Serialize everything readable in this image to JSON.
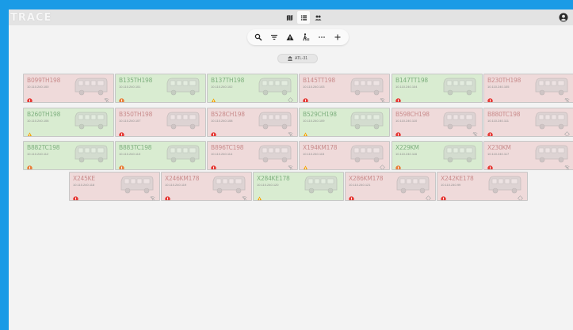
{
  "app": {
    "logo": "TRACE"
  },
  "header": {
    "views": [
      {
        "icon": "map-icon",
        "active": false
      },
      {
        "icon": "list-icon",
        "active": true
      },
      {
        "icon": "people-icon",
        "active": false
      }
    ],
    "account_icon": "account-circle-icon"
  },
  "toolbar": {
    "tools": [
      "search-icon",
      "filter-icon",
      "warning-icon",
      "pedestrian-icon",
      "more-icon",
      "add-icon"
    ]
  },
  "site": {
    "label": "ATL-31",
    "icon": "bank-icon"
  },
  "colors": {
    "red_card": "#efdada",
    "green_card": "#d9ecd1",
    "error": "#e53935",
    "warning": "#f5a300",
    "caution": "#e8803c"
  },
  "vehicles": [
    {
      "name": "B099TH198",
      "ip": "10.110.240.100",
      "state": "red",
      "status": "error",
      "conn": "wifi-off-icon"
    },
    {
      "name": "B135TH198",
      "ip": "10.110.240.101",
      "state": "green",
      "status": "caution",
      "conn": ""
    },
    {
      "name": "B137TH198",
      "ip": "10.110.240.102",
      "state": "green",
      "status": "warning",
      "conn": "signal-diamond-icon"
    },
    {
      "name": "B145TT198",
      "ip": "10.110.240.103",
      "state": "red",
      "status": "error",
      "conn": "wifi-off-icon"
    },
    {
      "name": "B147TT198",
      "ip": "10.110.240.104",
      "state": "green",
      "status": "error",
      "conn": ""
    },
    {
      "name": "B230TH198",
      "ip": "10.110.240.105",
      "state": "red",
      "status": "error",
      "conn": "wifi-off-icon"
    },
    {
      "name": "B260TH198",
      "ip": "10.110.240.106",
      "state": "green",
      "status": "warning",
      "conn": ""
    },
    {
      "name": "B350TH198",
      "ip": "10.110.240.107",
      "state": "red",
      "status": "error",
      "conn": ""
    },
    {
      "name": "B528CH198",
      "ip": "10.110.240.108",
      "state": "red",
      "status": "error",
      "conn": "wifi-off-icon"
    },
    {
      "name": "B529CH198",
      "ip": "10.110.240.109",
      "state": "green",
      "status": "warning",
      "conn": ""
    },
    {
      "name": "B598CH198",
      "ip": "10.110.240.110",
      "state": "red",
      "status": "error",
      "conn": "wifi-off-icon"
    },
    {
      "name": "B880TC198",
      "ip": "10.110.240.111",
      "state": "red",
      "status": "error",
      "conn": "signal-diamond-icon"
    },
    {
      "name": "B882TC198",
      "ip": "10.110.240.112",
      "state": "green",
      "status": "caution",
      "conn": ""
    },
    {
      "name": "B883TC198",
      "ip": "10.110.240.113",
      "state": "green",
      "status": "caution",
      "conn": ""
    },
    {
      "name": "B896TC198",
      "ip": "10.110.240.114",
      "state": "red",
      "status": "error",
      "conn": "wifi-off-icon"
    },
    {
      "name": "X194KM178",
      "ip": "10.110.240.115",
      "state": "red",
      "status": "warning",
      "conn": "signal-diamond-icon"
    },
    {
      "name": "X229KM",
      "ip": "10.110.240.116",
      "state": "green",
      "status": "caution",
      "conn": ""
    },
    {
      "name": "X230KM",
      "ip": "10.110.240.117",
      "state": "red",
      "status": "error",
      "conn": "wifi-off-icon"
    },
    {
      "name": "X245KE",
      "ip": "10.110.240.118",
      "state": "red",
      "status": "error",
      "conn": "wifi-off-icon"
    },
    {
      "name": "X246KM178",
      "ip": "10.110.240.119",
      "state": "red",
      "status": "error",
      "conn": "wifi-off-icon"
    },
    {
      "name": "X284KE178",
      "ip": "10.110.240.120",
      "state": "green",
      "status": "warning",
      "conn": ""
    },
    {
      "name": "X286KM178",
      "ip": "10.110.240.121",
      "state": "red",
      "status": "error",
      "conn": "signal-diamond-icon"
    },
    {
      "name": "X242KE178",
      "ip": "10.110.240.99",
      "state": "red",
      "status": "error",
      "conn": "signal-diamond-icon"
    }
  ]
}
